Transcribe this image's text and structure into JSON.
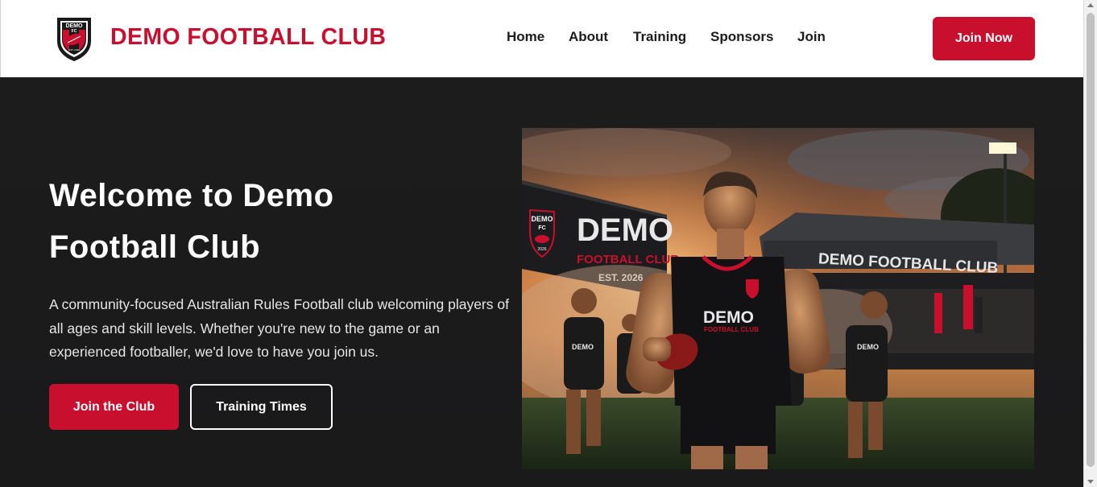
{
  "header": {
    "logo_icon": "club-shield-logo",
    "logo_text": [
      "DEMO",
      "FC",
      "EST. 2026"
    ],
    "brand": "DEMO FOOTBALL CLUB",
    "nav": [
      "Home",
      "About",
      "Training",
      "Sponsors",
      "Join"
    ],
    "cta": "Join Now"
  },
  "hero": {
    "title": "Welcome to Demo Football Club",
    "description": "A community-focused Australian Rules Football club welcoming players of all ages and skill levels. Whether you're new to the game or an experienced footballer, we'd love to have you join us.",
    "primary_button": "Join the Club",
    "secondary_button": "Training Times",
    "image": {
      "banner_lines": [
        "DEMO",
        "FOOTBALL CLUB",
        "EST. 2026"
      ],
      "banner_badge": [
        "DEMO",
        "FC",
        "2026"
      ],
      "grandstand_sign": "DEMO FOOTBALL CLUB",
      "jersey_text": [
        "DEMO",
        "FOOTBALL CLUB"
      ],
      "small_jersey_text": "DEMO"
    }
  },
  "colors": {
    "brand_red": "#c8102e",
    "hero_bg": "#1b1b1c",
    "header_bg": "#ffffff"
  }
}
